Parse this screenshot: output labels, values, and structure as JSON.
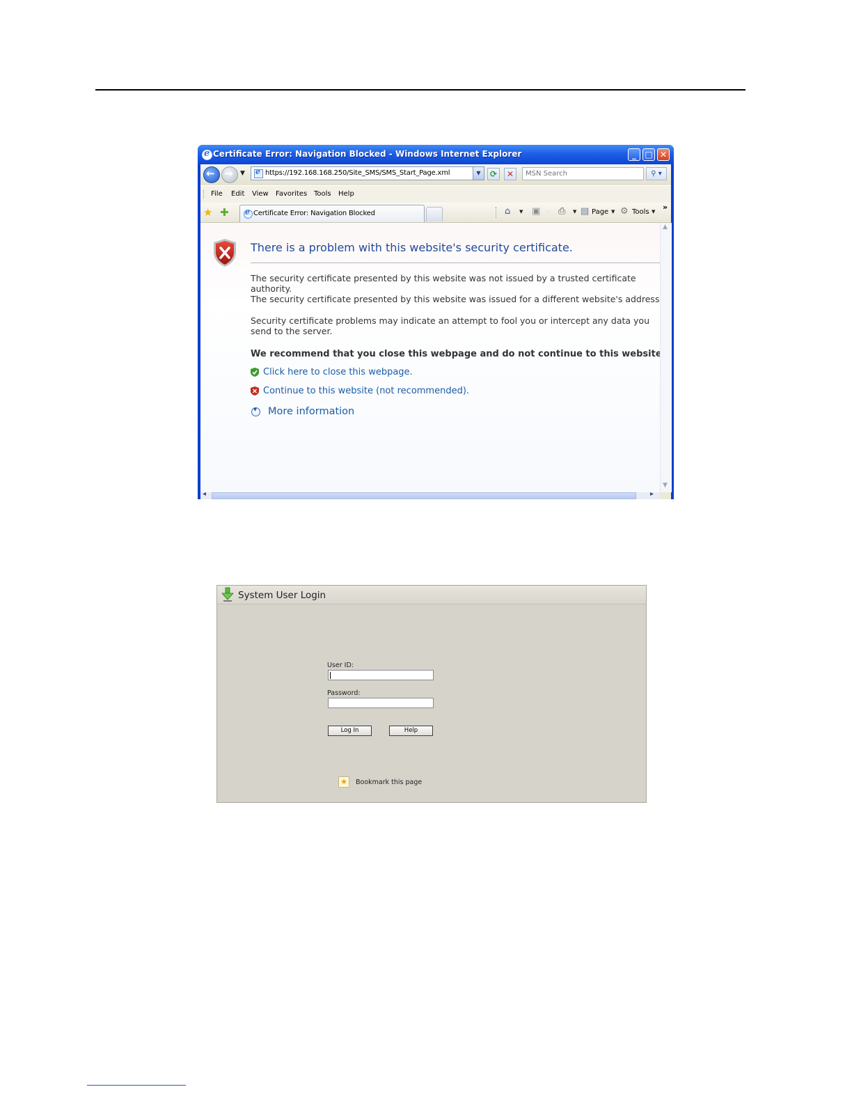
{
  "ie_window": {
    "title": "Certificate Error: Navigation Blocked - Windows Internet Explorer",
    "window_buttons": {
      "minimize": "_",
      "maximize": "□",
      "close": "✕"
    },
    "address": "https://192.168.168.250/Site_SMS/SMS_Start_Page.xml",
    "search_placeholder": "MSN Search",
    "menu": [
      "File",
      "Edit",
      "View",
      "Favorites",
      "Tools",
      "Help"
    ],
    "tab_label": "Certificate Error: Navigation Blocked",
    "toolbar": {
      "page_label": "Page",
      "tools_label": "Tools",
      "overflow": "»"
    },
    "icons": [
      "back-icon",
      "forward-icon",
      "refresh-icon",
      "stop-icon",
      "search-icon",
      "favorites-star-icon",
      "add-favorites-icon",
      "home-icon",
      "feeds-icon",
      "print-icon",
      "page-icon",
      "tools-gear-icon",
      "shield-error-icon"
    ]
  },
  "cert_error": {
    "title": "There is a problem with this website's security certificate.",
    "lines": [
      "The security certificate presented by this website was not issued by a trusted certificate",
      "authority.",
      "The security certificate presented by this website was issued for a different website's address"
    ],
    "warning_lines": [
      "Security certificate problems may indicate an attempt to fool you or intercept any data you",
      "send to the server."
    ],
    "recommendation": "We recommend that you close this webpage and do not continue to this website.",
    "close_link": "Click here to close this webpage.",
    "continue_link": "Continue to this website (not recommended).",
    "more_info": "More information"
  },
  "login": {
    "title": "System User Login",
    "user_id_label": "User ID:",
    "user_id_value": "",
    "password_label": "Password:",
    "password_value": "",
    "login_button": "Log In",
    "help_button": "Help",
    "bookmark_text": "Bookmark this page"
  },
  "colors": {
    "titlebar": "#1f5fe6",
    "link": "#1a5ca8",
    "heading": "#1f4b9b",
    "login_bg": "#d6d3cb"
  }
}
